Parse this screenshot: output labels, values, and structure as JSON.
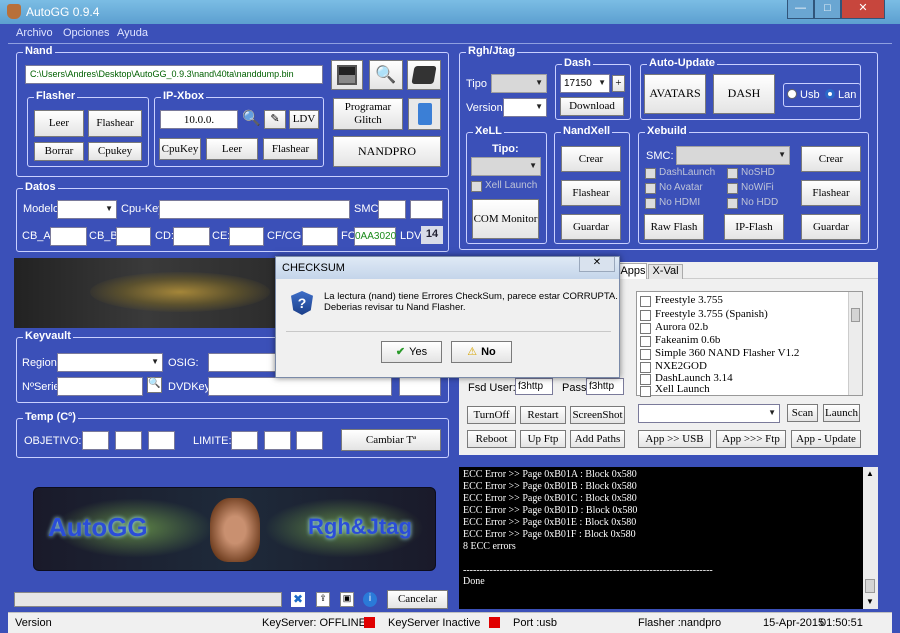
{
  "window": {
    "title": "AutoGG 0.9.4",
    "min": "—",
    "max": "□",
    "close": "✕"
  },
  "menu": [
    "Archivo",
    "Opciones",
    "Ayuda"
  ],
  "nand": {
    "label": "Nand",
    "path": "C:\\Users\\Andres\\Desktop\\AutoGG_0.9.3\\nand\\40ta\\nanddump.bin"
  },
  "flasher": {
    "label": "Flasher",
    "leer": "Leer",
    "flashear": "Flashear",
    "borrar": "Borrar",
    "cpukey": "Cpukey"
  },
  "ipxbox": {
    "label": "IP-Xbox",
    "ip": "10.0.0.",
    "ldv": "LDV",
    "cpukey": "CpuKey",
    "leer": "Leer",
    "flashear": "Flashear"
  },
  "programar_glitch": "Programar Glitch",
  "nandpro": "NANDPRO",
  "datos": {
    "label": "Datos",
    "modelo": "Modelo:",
    "cpukey": "Cpu-Key",
    "smc": "SMC:",
    "cba": "CB_A:",
    "cbb": "CB_B:",
    "cd": "CD:",
    "ce": "CE:",
    "cfcg": "CF/CG:",
    "fc": "FC:",
    "fc_value": "0AA3020",
    "ldv": "LDV:",
    "ldv_value": "14"
  },
  "rgh": {
    "label": "Rgh/Jtag",
    "tipo": "Tipo",
    "version": "Version:"
  },
  "dash": {
    "label": "Dash",
    "value": "17150",
    "plus": "+",
    "download": "Download"
  },
  "autoupdate": {
    "label": "Auto-Update",
    "avatars": "AVATARS",
    "dash": "DASH",
    "usb": "Usb",
    "lan": "Lan"
  },
  "xell": {
    "label": "XeLL",
    "tipo": "Tipo:",
    "xell_launch": "Xell Launch",
    "com_monitor": "COM Monitor"
  },
  "nandxell": {
    "label": "NandXell",
    "crear": "Crear",
    "flashear": "Flashear",
    "guardar": "Guardar"
  },
  "xebuild": {
    "label": "Xebuild",
    "smc": "SMC:",
    "crear": "Crear",
    "flashear": "Flashear",
    "guardar": "Guardar",
    "raw_flash": "Raw Flash",
    "ip_flash": "IP-Flash",
    "checks": [
      "DashLaunch",
      "No Avatar",
      "No HDMI",
      "NoSHD",
      "NoWiFi",
      "No HDD"
    ]
  },
  "keyvault": {
    "label": "Keyvault",
    "region": "Region:",
    "osig": "OSIG:",
    "serie": "NºSerie:",
    "dvdkey": "DVDKey:"
  },
  "temp": {
    "label": "Temp (Cº)",
    "objetivo": "OBJETIVO:",
    "limite": "LIMITE:",
    "cambiar": "Cambiar Tª"
  },
  "banner": {
    "left": "AutoGG",
    "right": "Rgh&Jtag"
  },
  "cancelar": "Cancelar",
  "tabs": {
    "apps": "Apps",
    "xval": "X-Val"
  },
  "apps_list": [
    "Freestyle 3.755",
    "Freestyle 3.755 (Spanish)",
    "Aurora 02.b",
    "Fakeanim 0.6b",
    "Simple 360 NAND Flasher V1.2",
    "NXE2GOD",
    "DashLaunch 3.14",
    "Xell Launch"
  ],
  "ftp": {
    "user_label": "Fsd User:",
    "user": "f3http",
    "pass_label": "Pass:",
    "pass": "f3http"
  },
  "ftpbtns": {
    "scan": "Scan",
    "launch": "Launch",
    "turnoff": "TurnOff",
    "restart": "Restart",
    "screenshot": "ScreenShot",
    "reboot": "Reboot",
    "upftp": "Up Ftp",
    "addpaths": "Add Paths",
    "app_usb": "App >> USB",
    "app_ftp": "App >>> Ftp",
    "app_update": "App - Update"
  },
  "log": [
    "ECC Error >> Page 0xB01A : Block 0x580",
    "ECC Error >> Page 0xB01B : Block 0x580",
    "ECC Error >> Page 0xB01C : Block 0x580",
    "ECC Error >> Page 0xB01D : Block 0x580",
    "ECC Error >> Page 0xB01E : Block 0x580",
    "ECC Error >> Page 0xB01F : Block 0x580",
    "8 ECC errors",
    "---------------------------------------------------------------------------",
    "Done"
  ],
  "dialog": {
    "title": "CHECKSUM",
    "close": "✕",
    "line1": "La lectura (nand) tiene Errores CheckSum, parece estar CORRUPTA.",
    "line2": "Deberias revisar tu Nand Flasher.",
    "yes": "Yes",
    "no": "No"
  },
  "status": {
    "version": "Version",
    "keyserver": "KeyServer: OFFLINE",
    "keyserver_state": "KeyServer Inactive",
    "port": "Port :usb",
    "flasher": "Flasher :nandpro",
    "date": "15-Apr-2015",
    "time": "01:50:51"
  }
}
